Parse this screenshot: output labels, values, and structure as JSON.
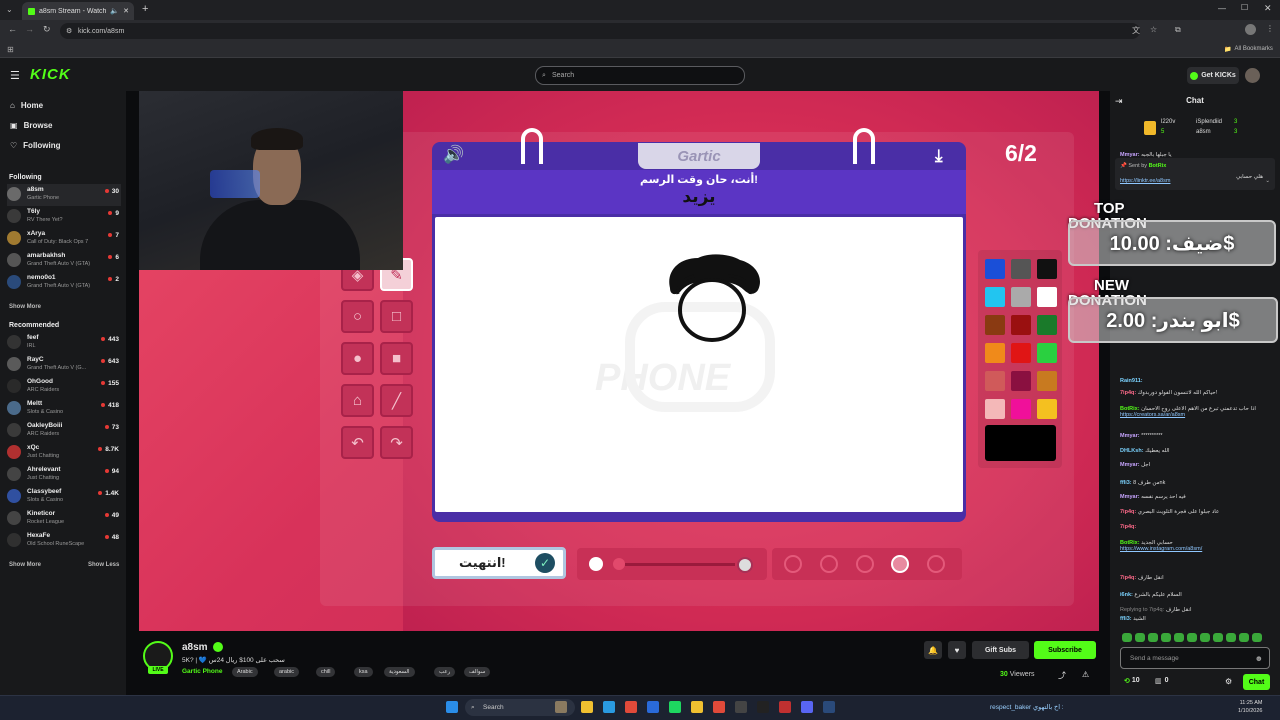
{
  "browser": {
    "tab_title": "a8sm Stream - Watch Live ...",
    "url": "kick.com/a8sm",
    "all_bookmarks": "All Bookmarks"
  },
  "header": {
    "logo": "KICK",
    "search_placeholder": "Search",
    "get_kicks": "Get KICKs"
  },
  "sidebar": {
    "nav": [
      {
        "label": "Home"
      },
      {
        "label": "Browse"
      },
      {
        "label": "Following"
      }
    ],
    "following_title": "Following",
    "following": [
      {
        "name": "a8sm",
        "game": "Gartic Phone",
        "viewers": "30"
      },
      {
        "name": "T6ly",
        "game": "RV There Yet?",
        "viewers": "9"
      },
      {
        "name": "xArya",
        "game": "Call of Duty: Black Ops 7",
        "viewers": "7"
      },
      {
        "name": "amarbakhsh",
        "game": "Grand Theft Auto V (GTA)",
        "viewers": "6"
      },
      {
        "name": "nemo0o1",
        "game": "Grand Theft Auto V (GTA)",
        "viewers": "2"
      }
    ],
    "show_more_1": "Show More",
    "recommended_title": "Recommended",
    "recommended": [
      {
        "name": "feef",
        "game": "IRL",
        "viewers": "443"
      },
      {
        "name": "RayC",
        "game": "Grand Theft Auto V (G...",
        "viewers": "643"
      },
      {
        "name": "OhGood",
        "game": "ARC Raiders",
        "viewers": "155"
      },
      {
        "name": "Meltt",
        "game": "Slots & Casino",
        "viewers": "418"
      },
      {
        "name": "OakleyBoiii",
        "game": "ARC Raiders",
        "viewers": "73"
      },
      {
        "name": "xQc",
        "game": "Just Chatting",
        "viewers": "8.7K"
      },
      {
        "name": "Ahrelevant",
        "game": "Just Chatting",
        "viewers": "94"
      },
      {
        "name": "Classybeef",
        "game": "Slots & Casino",
        "viewers": "1.4K"
      },
      {
        "name": "Kineticor",
        "game": "Rocket League",
        "viewers": "49"
      },
      {
        "name": "HexaFe",
        "game": "Old School RuneScape",
        "viewers": "48"
      }
    ],
    "show_more_2": "Show More",
    "show_less": "Show Less"
  },
  "game": {
    "title": "Gartic",
    "prompt": "أنت، حان وقت الرسم!",
    "word": "يزيد",
    "counter": "6/2",
    "watermark": "PHONE",
    "done_button": "انتهيت!",
    "colors": [
      "#1a4fd8",
      "#555555",
      "#111111",
      "#22c5f0",
      "#aaaaaa",
      "#ffffff",
      "#8a3a12",
      "#9a1010",
      "#1a7a2a",
      "#f08a1a",
      "#e01515",
      "#2ad040",
      "#d05a5a",
      "#8a1040",
      "#c87a20",
      "#f4b8b8",
      "#f0109a",
      "#f4c020",
      "#000000"
    ]
  },
  "overlay": {
    "top_label": "TOP",
    "donation_label": "DONATION",
    "top_amount": "ضيف: 10.00$",
    "new_label": "NEW",
    "new_donation_label": "DONATION",
    "new_amount": "ابو بندر: 2.00$"
  },
  "chat": {
    "title": "Chat",
    "top_gifters": [
      {
        "name": "l220v",
        "count": "5"
      },
      {
        "name": "iSplendiid",
        "count": "3"
      },
      {
        "name": "a8sm",
        "count": "3"
      }
    ],
    "pinned_by": "Sent by",
    "pinned_user": "BotRix",
    "pinned_text": "هلي حسابي",
    "pinned_link": "https://linktr.ee/a8sm",
    "messages": [
      {
        "user": "Mmyar:",
        "text": "يا جبلها بالجبه"
      },
      {
        "user": "Rain911:",
        "text": ""
      },
      {
        "user": "7ip4q:",
        "text": "حياكم الله لاتنسون الفولو دوربدوك!"
      },
      {
        "user": "BotRix:",
        "text": "اذا حاب تدعمني تبرع من الاهم الاعلى روح الاحسان",
        "link": "https://creators.sa/ar/a8sm"
      },
      {
        "user": "Mmyar:",
        "text": "**********"
      },
      {
        "user": "DHLKsh:",
        "text": "الله يعطيك"
      },
      {
        "user": "Mmyar:",
        "text": "اجل"
      },
      {
        "user": "ffli3:",
        "text": "من طرف 8nk"
      },
      {
        "user": "Mmyar:",
        "text": "فيه احد يرسم نفسه"
      },
      {
        "user": "7ip4q:",
        "text": "عاد جبلوا على فجرة التلويث البصري"
      },
      {
        "user": "7ip4q:",
        "text": ""
      },
      {
        "user": "BotRix:",
        "text": "حسابي الجديد",
        "link": "https://www.instagram.com/a8sm/"
      },
      {
        "user": "7ip4q:",
        "text": "انقل طارف"
      },
      {
        "user": "i6nk:",
        "text": "السلام عليكم بالشرع"
      },
      {
        "user": "Replying to 7ip4q:",
        "text": "انقل طارف"
      },
      {
        "user": "ffli3:",
        "text": "الشيد"
      }
    ],
    "input_placeholder": "Send a message",
    "points": "10",
    "gifts": "0",
    "chat_button": "Chat"
  },
  "channel": {
    "name": "a8sm",
    "live": "LIVE",
    "title": "5K? | 💙 سحب على 100$ ريال 24س",
    "game": "Gartic Phone",
    "tags": [
      "Arabic",
      "arabic",
      "chill",
      "ksa",
      "السعودية",
      "رعب",
      "سوالف"
    ],
    "gift_subs": "Gift Subs",
    "subscribe": "Subscribe",
    "viewers": "30",
    "viewers_label": "Viewers"
  },
  "taskbar": {
    "search": "Search",
    "time": "11:25 AM",
    "date": "1/10/2026",
    "ticker_user": "respect_baker",
    "ticker_text": "اخ بالتهوي :"
  }
}
